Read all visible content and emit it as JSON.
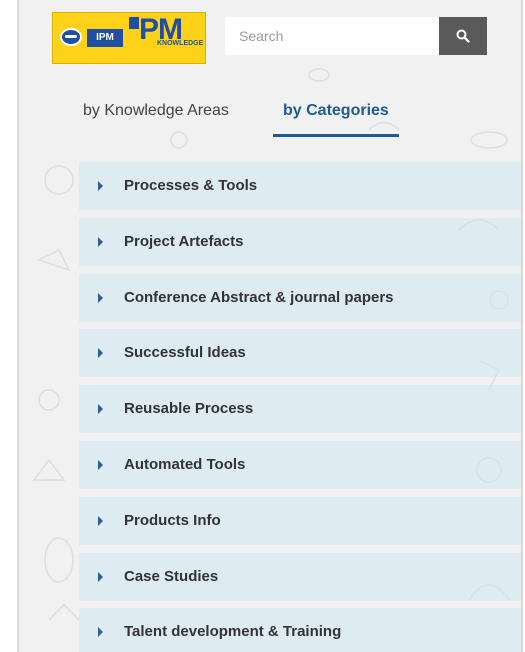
{
  "header": {
    "logo": {
      "ipm_text": "IPM",
      "pm_text": "PM",
      "knowledge_text": "KNOWLEDGE",
      "icon": "ipm-globe-logo-icon"
    },
    "search": {
      "placeholder": "Search",
      "value": "",
      "button_icon": "search-icon"
    }
  },
  "tabs": [
    {
      "label": "by Knowledge Areas",
      "active": false
    },
    {
      "label": "by Categories",
      "active": true
    }
  ],
  "categories": [
    {
      "label": "Processes & Tools",
      "icon": "caret-right-icon"
    },
    {
      "label": "Project Artefacts",
      "icon": "caret-right-icon"
    },
    {
      "label": "Conference Abstract & journal papers",
      "icon": "caret-right-icon"
    },
    {
      "label": "Successful Ideas",
      "icon": "caret-right-icon"
    },
    {
      "label": "Reusable Process",
      "icon": "caret-right-icon"
    },
    {
      "label": "Automated Tools",
      "icon": "caret-right-icon"
    },
    {
      "label": "Products Info",
      "icon": "caret-right-icon"
    },
    {
      "label": "Case Studies",
      "icon": "caret-right-icon"
    },
    {
      "label": "Talent development & Training",
      "icon": "caret-right-icon"
    }
  ],
  "colors": {
    "accent": "#1f5a94",
    "logo_bg": "#ffd21a",
    "search_button": "#5a5a5a",
    "list_row": "#cde6f0"
  }
}
